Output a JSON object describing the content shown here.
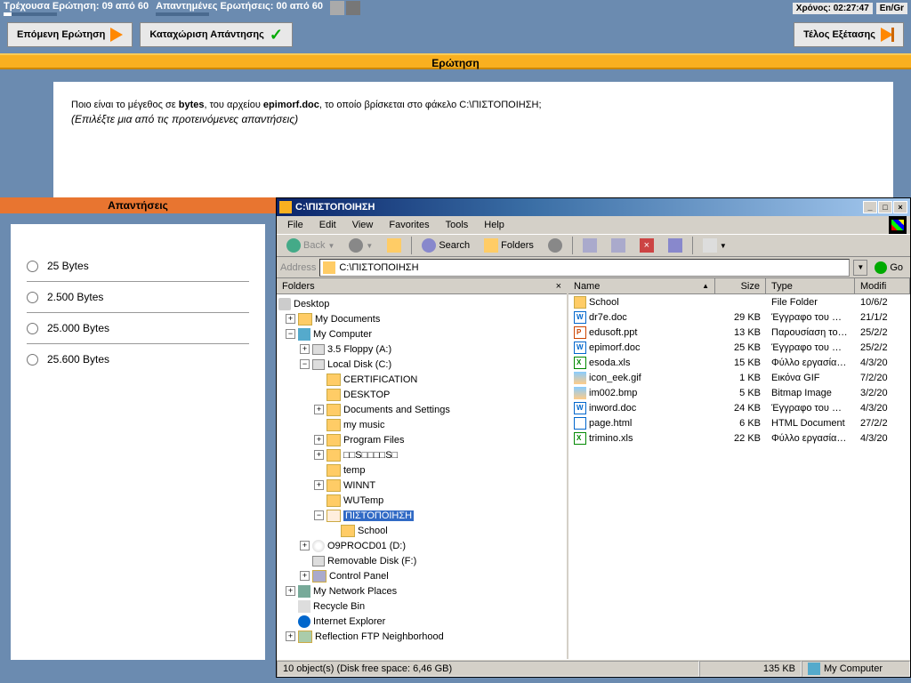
{
  "topbar": {
    "current_q": "Τρέχουσα Ερώτηση: 09 από 60",
    "answered_q": "Απαντημένες Ερωτήσεις: 00 από 60",
    "time_label": "Χρόνος: 02:27:47",
    "lang": "En/Gr"
  },
  "buttons": {
    "next": "Επόμενη Ερώτηση",
    "submit": "Καταχώριση Απάντησης",
    "end": "Τέλος Εξέτασης"
  },
  "question": {
    "title": "Ερώτηση",
    "text1": "Ποιο είναι το μέγεθος σε ",
    "bold1": "bytes",
    "text2": ", του αρχείου ",
    "bold2": "epimorf.doc",
    "text3": ", το οποίο βρίσκεται στο φάκελο C:\\ΠΙΣΤΟΠΟΙΗΣΗ;",
    "hint": "(Επιλέξτε μια από τις προτεινόμενες απαντήσεις)"
  },
  "answers": {
    "header": "Απαντήσεις",
    "options": [
      "25 Bytes",
      "2.500 Bytes",
      "25.000 Bytes",
      "25.600 Bytes"
    ]
  },
  "explorer": {
    "title": "C:\\ΠΙΣΤΟΠΟΙΗΣΗ",
    "menu": [
      "File",
      "Edit",
      "View",
      "Favorites",
      "Tools",
      "Help"
    ],
    "toolbar": {
      "back": "Back",
      "search": "Search",
      "folders": "Folders"
    },
    "address_label": "Address",
    "address_value": "C:\\ΠΙΣΤΟΠΟΙΗΣΗ",
    "go": "Go",
    "folders_header": "Folders",
    "tree": {
      "desktop": "Desktop",
      "mydocs": "My Documents",
      "mycomp": "My Computer",
      "floppy": "3.5 Floppy (A:)",
      "localc": "Local Disk (C:)",
      "cert": "CERTIFICATION",
      "desktopf": "DESKTOP",
      "docset": "Documents and Settings",
      "music": "my music",
      "progf": "Program Files",
      "unk": "□□S□□□□S□",
      "temp": "temp",
      "winnt": "WINNT",
      "wutemp": "WUTemp",
      "pisto": "ΠΙΣΤΟΠΟΙΗΣΗ",
      "school": "School",
      "cdrom": "O9PROCD01 (D:)",
      "remov": "Removable Disk (F:)",
      "ctrl": "Control Panel",
      "netplaces": "My Network Places",
      "recycle": "Recycle Bin",
      "ie": "Internet Explorer",
      "ftp": "Reflection FTP Neighborhood"
    },
    "columns": {
      "name": "Name",
      "size": "Size",
      "type": "Type",
      "modified": "Modifi"
    },
    "files": [
      {
        "name": "School",
        "size": "",
        "type": "File Folder",
        "mod": "10/6/2",
        "icon": "folder"
      },
      {
        "name": "dr7e.doc",
        "size": "29 KB",
        "type": "Έγγραφο του Micro...",
        "mod": "21/1/2",
        "icon": "doc"
      },
      {
        "name": "edusoft.ppt",
        "size": "13 KB",
        "type": "Παρουσίαση του Mic...",
        "mod": "25/2/2",
        "icon": "ppt"
      },
      {
        "name": "epimorf.doc",
        "size": "25 KB",
        "type": "Έγγραφο του Micro...",
        "mod": "25/2/2",
        "icon": "doc"
      },
      {
        "name": "esoda.xls",
        "size": "15 KB",
        "type": "Φύλλο εργασίας το...",
        "mod": "4/3/20",
        "icon": "xls"
      },
      {
        "name": "icon_eek.gif",
        "size": "1 KB",
        "type": "Εικόνα GIF",
        "mod": "7/2/20",
        "icon": "img"
      },
      {
        "name": "im002.bmp",
        "size": "5 KB",
        "type": "Bitmap Image",
        "mod": "3/2/20",
        "icon": "img"
      },
      {
        "name": "inword.doc",
        "size": "24 KB",
        "type": "Έγγραφο του Micro...",
        "mod": "4/3/20",
        "icon": "doc"
      },
      {
        "name": "page.html",
        "size": "6 KB",
        "type": "HTML Document",
        "mod": "27/2/2",
        "icon": "html"
      },
      {
        "name": "trimino.xls",
        "size": "22 KB",
        "type": "Φύλλο εργασίας το...",
        "mod": "4/3/20",
        "icon": "xls"
      }
    ],
    "statusbar": {
      "objects": "10 object(s) (Disk free space: 6,46 GB)",
      "size": "135 KB",
      "location": "My Computer"
    }
  }
}
